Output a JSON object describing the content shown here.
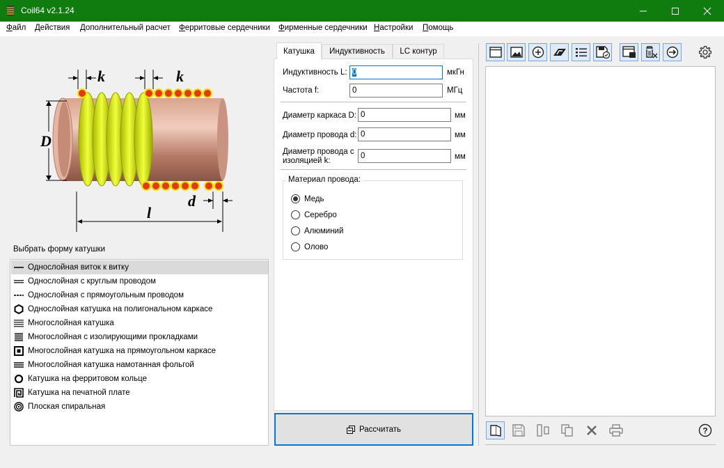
{
  "window": {
    "title": "Coil64 v2.1.24",
    "controls": [
      "minimize-icon",
      "maximize-icon",
      "close-icon"
    ],
    "accent": "#107c10"
  },
  "menu": [
    {
      "label": "Файл",
      "u": "Ф",
      "rest": "айл"
    },
    {
      "label": "Действия",
      "u": "Д",
      "rest": "ействия"
    },
    {
      "label": "Дополнительный расчет",
      "u": "Д",
      "rest": "ополнительный расчет"
    },
    {
      "label": "Ферритовые сердечники",
      "u": "Ф",
      "rest": "ерритовые сердечники"
    },
    {
      "label": "Фирменные сердечники",
      "u": "Ф",
      "rest": "ирменные сердечники"
    },
    {
      "label": "Настройки",
      "u": "Н",
      "rest": "астройки"
    },
    {
      "label": "Помощь",
      "u": "П",
      "rest": "омощь"
    }
  ],
  "figure": {
    "labels": {
      "k1": "k",
      "k2": "k",
      "D": "D",
      "d": "d",
      "l": "l"
    }
  },
  "shape_group": {
    "title": "Выбрать форму катушки",
    "items": [
      {
        "label": "Однослойная виток к витку",
        "icon": "single-layer-close-icon"
      },
      {
        "label": "Однослойная с круглым проводом",
        "icon": "single-layer-round-wire-icon"
      },
      {
        "label": "Однослойная с прямоугольным проводом",
        "icon": "single-layer-rect-wire-icon"
      },
      {
        "label": "Однослойная катушка на полигональном каркасе",
        "icon": "hexagon-icon"
      },
      {
        "label": "Многослойная катушка",
        "icon": "multilayer-icon"
      },
      {
        "label": "Многослойная с изолирующими прокладками",
        "icon": "multilayer-insulated-icon"
      },
      {
        "label": "Многослойная катушка на прямоугольном каркасе",
        "icon": "multilayer-rect-icon"
      },
      {
        "label": "Многослойная катушка намотанная фольгой",
        "icon": "foil-icon"
      },
      {
        "label": "Катушка на ферритовом кольце",
        "icon": "ring-icon"
      },
      {
        "label": "Катушка на печатной плате",
        "icon": "pcb-spiral-icon"
      },
      {
        "label": "Плоская спиральная",
        "icon": "flat-spiral-icon"
      }
    ],
    "selected_index": 0
  },
  "tabs": [
    {
      "label": "Катушка"
    },
    {
      "label": "Индуктивность"
    },
    {
      "label": "LC контур"
    }
  ],
  "form": {
    "inductance": {
      "label": "Индуктивность L:",
      "value": "0",
      "unit": "мкГн"
    },
    "frequency": {
      "label": "Частота f:",
      "value": "0",
      "unit": "МГц"
    },
    "former_diameter": {
      "label": "Диаметр каркаса D:",
      "value": "0",
      "unit": "мм"
    },
    "wire_diameter": {
      "label": "Диаметр провода d:",
      "value": "0",
      "unit": "мм"
    },
    "wire_diameter_ins": {
      "label1": "Диаметр провода с",
      "label2": "изоляцией k:",
      "value": "0",
      "unit": "мм"
    },
    "material": {
      "title": "Материал провода:",
      "options": [
        "Медь",
        "Серебро",
        "Алюминий",
        "Олово"
      ],
      "selected": "Медь"
    }
  },
  "calculate_button": {
    "label": "Рассчитать",
    "icon": "calculate-icon"
  },
  "right_toolbar": [
    {
      "name": "window-icon"
    },
    {
      "name": "image-icon"
    },
    {
      "name": "add-circle-icon"
    },
    {
      "name": "scale-icon"
    },
    {
      "name": "list-icon"
    },
    {
      "name": "save-check-icon"
    },
    {
      "name": "window-save-icon"
    },
    {
      "name": "delete-list-icon"
    },
    {
      "name": "arrow-circle-icon"
    },
    {
      "name": "gear-icon"
    }
  ],
  "bottom_toolbar": [
    {
      "name": "open-book-icon"
    },
    {
      "name": "save-icon"
    },
    {
      "name": "columns-icon"
    },
    {
      "name": "copy-icon"
    },
    {
      "name": "clear-icon"
    },
    {
      "name": "print-icon"
    },
    {
      "name": "help-icon"
    }
  ]
}
